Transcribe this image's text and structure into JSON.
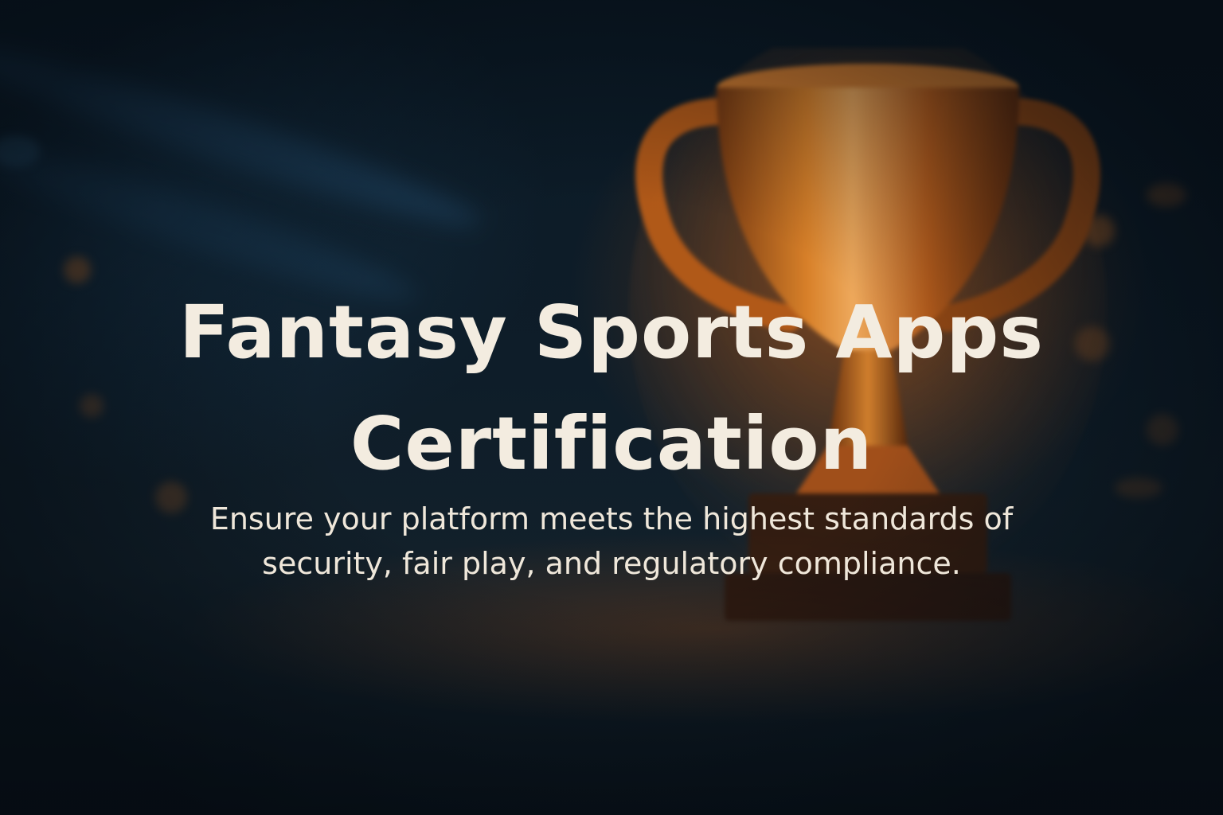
{
  "hero": {
    "title_line_1": "Fantasy Sports Apps",
    "title_line_2": "Certification",
    "subtitle_line_1": "Ensure your platform meets the highest standards of",
    "subtitle_line_2": "security, fair play, and regulatory compliance."
  },
  "colors": {
    "text": "#f3ece0",
    "background": "#0b1a26",
    "trophy": "#c66a1e"
  },
  "icons": {
    "background_image": "trophy-icon"
  }
}
